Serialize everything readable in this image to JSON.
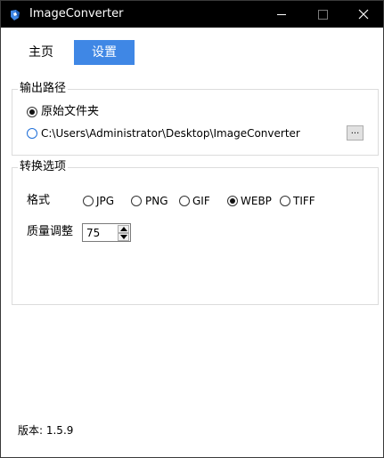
{
  "window": {
    "title": "ImageConverter"
  },
  "tabs": {
    "home": "主页",
    "settings": "设置"
  },
  "output": {
    "legend": "输出路径",
    "option_original": "原始文件夹",
    "option_custom_path": "C:\\Users\\Administrator\\Desktop\\ImageConverter",
    "browse_label": "...",
    "selected": "original"
  },
  "options": {
    "legend": "转换选项",
    "format_label": "格式",
    "formats": [
      "JPG",
      "PNG",
      "GIF",
      "WEBP",
      "TIFF"
    ],
    "selected_format": "WEBP",
    "quality_label": "质量调整",
    "quality_value": "75"
  },
  "footer": {
    "version": "版本: 1.5.9"
  },
  "colors": {
    "accent": "#3f87e5",
    "titlebar": "#000000"
  },
  "icons": [
    "app-icon",
    "minimize-icon",
    "maximize-icon",
    "close-icon",
    "spin-up-icon",
    "spin-down-icon"
  ]
}
